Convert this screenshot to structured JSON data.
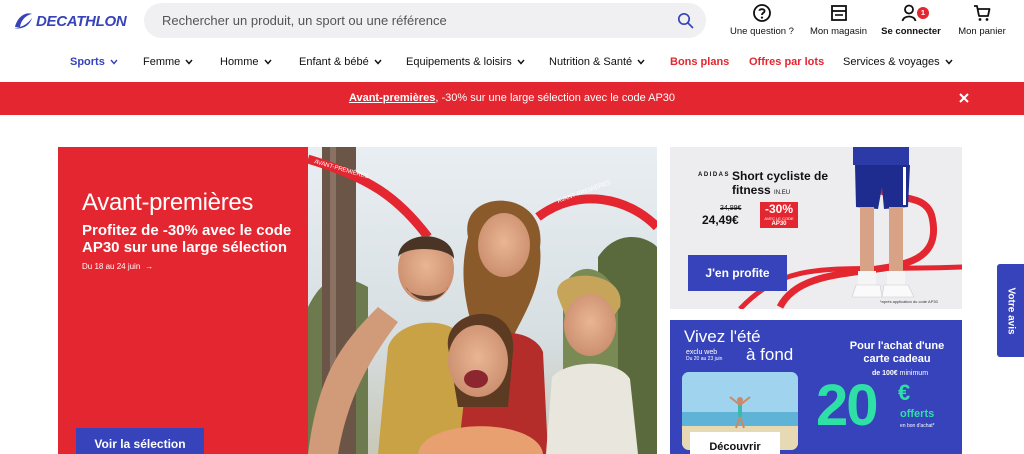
{
  "header": {
    "logo": "DECATHLON",
    "search_placeholder": "Rechercher un produit, un sport ou une référence",
    "actions": [
      {
        "label": "Une question ?",
        "icon": "question-icon"
      },
      {
        "label": "Mon magasin",
        "icon": "store-icon"
      },
      {
        "label": "Se connecter",
        "icon": "user-icon",
        "badge": "1"
      },
      {
        "label": "Mon panier",
        "icon": "cart-icon"
      }
    ]
  },
  "nav": {
    "items": [
      {
        "label": "Sports",
        "dropdown": true,
        "style": "active"
      },
      {
        "label": "Femme",
        "dropdown": true
      },
      {
        "label": "Homme",
        "dropdown": true
      },
      {
        "label": "Enfant & bébé",
        "dropdown": true
      },
      {
        "label": "Equipements & loisirs",
        "dropdown": true
      },
      {
        "label": "Nutrition & Santé",
        "dropdown": true
      },
      {
        "label": "Bons plans",
        "dropdown": false,
        "style": "promo"
      },
      {
        "label": "Offres par lots",
        "dropdown": false,
        "style": "promo"
      },
      {
        "label": "Services & voyages",
        "dropdown": true
      }
    ]
  },
  "banner": {
    "link_text": "Avant-premières",
    "text": ", -30% sur une large sélection avec le code AP30",
    "color": "#e3262f"
  },
  "hero": {
    "title": "Avant-premières",
    "subtitle": "Profitez de -30% avec le code AP30 sur une large sélection",
    "dates": "Du 18 au 24 juin",
    "dates_arrow": "→",
    "button": "Voir la sélection",
    "ribbon_text": "AVANT-PREMIÈRES"
  },
  "card_short": {
    "brand": "ADIDAS",
    "title": "Short cycliste de fitness",
    "title_sup": "IN.EU",
    "old_price": "34,99€",
    "new_price": "24,49€",
    "discount": "-30%",
    "discount_small": "AVEC LE CODE",
    "code": "AP30",
    "button": "J'en profite",
    "note": "*après application du code AP30"
  },
  "card_gift": {
    "title_line1": "Vivez l'été",
    "title_line2": "à fond",
    "exclu": "exclu web",
    "exclu_dates": "Du 20 au 23 juin",
    "offer": "Pour l'achat d'une carte cadeau",
    "min_amount": "de 100€",
    "min_suffix": "minimum",
    "big_number": "20",
    "currency": "€",
    "offerts": "offerts",
    "bon": "en bon d'achat*",
    "button": "Découvrir"
  },
  "feedback_tab": "Votre avis",
  "colors": {
    "brand": "#3643ba",
    "promo_red": "#e3262f",
    "mint": "#2fe0a6"
  }
}
